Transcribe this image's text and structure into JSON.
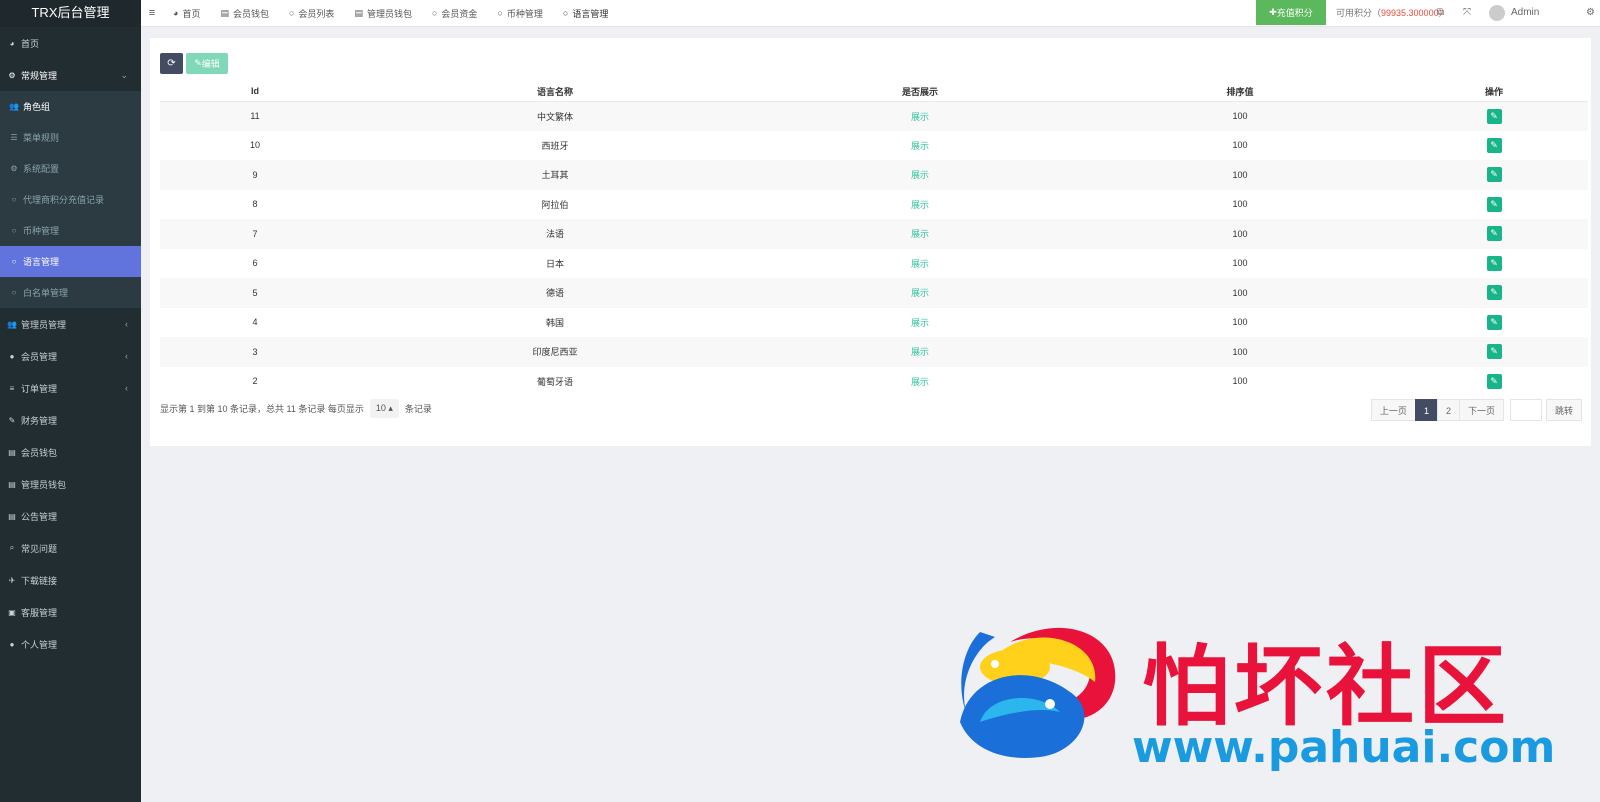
{
  "brand": "TRX后台管理",
  "sidebar": {
    "home": {
      "icon": "dashboard-icon",
      "label": "首页"
    },
    "common": {
      "icon": "gears-icon",
      "label": "常规管理"
    },
    "sub_items": [
      {
        "label": "角色组"
      },
      {
        "label": "菜单规则"
      },
      {
        "label": "系统配置"
      },
      {
        "label": "代理商积分充值记录"
      },
      {
        "label": "币种管理"
      },
      {
        "label": "语言管理"
      },
      {
        "label": "白名单管理"
      }
    ],
    "items": [
      {
        "label": "管理员管理"
      },
      {
        "label": "会员管理"
      },
      {
        "label": "订单管理"
      },
      {
        "label": "财务管理"
      },
      {
        "label": "会员钱包"
      },
      {
        "label": "管理员钱包"
      },
      {
        "label": "公告管理"
      },
      {
        "label": "常见问题"
      },
      {
        "label": "下载链接"
      },
      {
        "label": "客服管理"
      },
      {
        "label": "个人管理"
      }
    ]
  },
  "topbar": {
    "tabs": [
      {
        "label": "首页"
      },
      {
        "label": "会员钱包"
      },
      {
        "label": "会员列表"
      },
      {
        "label": "管理员钱包"
      },
      {
        "label": "会员资金"
      },
      {
        "label": "币种管理"
      },
      {
        "label": "语言管理"
      }
    ],
    "recharge_label": "充值积分",
    "credit_label": "可用积分（",
    "credit_value": "99935.300000",
    "credit_suffix": "）",
    "user": "Admin"
  },
  "toolbar": {
    "edit_label": "编辑"
  },
  "table": {
    "headers": [
      "Id",
      "语言名称",
      "是否展示",
      "排序值",
      "操作"
    ],
    "rows": [
      {
        "id": "11",
        "name": "中文繁体",
        "show": "展示",
        "sort": "100"
      },
      {
        "id": "10",
        "name": "西班牙",
        "show": "展示",
        "sort": "100"
      },
      {
        "id": "9",
        "name": "土耳其",
        "show": "展示",
        "sort": "100"
      },
      {
        "id": "8",
        "name": "阿拉伯",
        "show": "展示",
        "sort": "100"
      },
      {
        "id": "7",
        "name": "法语",
        "show": "展示",
        "sort": "100"
      },
      {
        "id": "6",
        "name": "日本",
        "show": "展示",
        "sort": "100"
      },
      {
        "id": "5",
        "name": "德语",
        "show": "展示",
        "sort": "100"
      },
      {
        "id": "4",
        "name": "韩国",
        "show": "展示",
        "sort": "100"
      },
      {
        "id": "3",
        "name": "印度尼西亚",
        "show": "展示",
        "sort": "100"
      },
      {
        "id": "2",
        "name": "葡萄牙语",
        "show": "展示",
        "sort": "100"
      }
    ]
  },
  "footer": {
    "summary": "显示第 1 到第 10 条记录，总共 11 条记录 每页显示",
    "page_size": "10 ▴",
    "suffix": "条记录"
  },
  "pager": {
    "prev": "上一页",
    "pages": [
      "1",
      "2"
    ],
    "next": "下一页",
    "go": "跳转"
  },
  "watermark": {
    "text": "怕坏社区",
    "url": "www.pahuai.com"
  },
  "colors": {
    "sidebar_bg": "#222d32",
    "active": "#6173dc",
    "accent_green": "#18b48a",
    "recharge": "#5cb85c"
  }
}
